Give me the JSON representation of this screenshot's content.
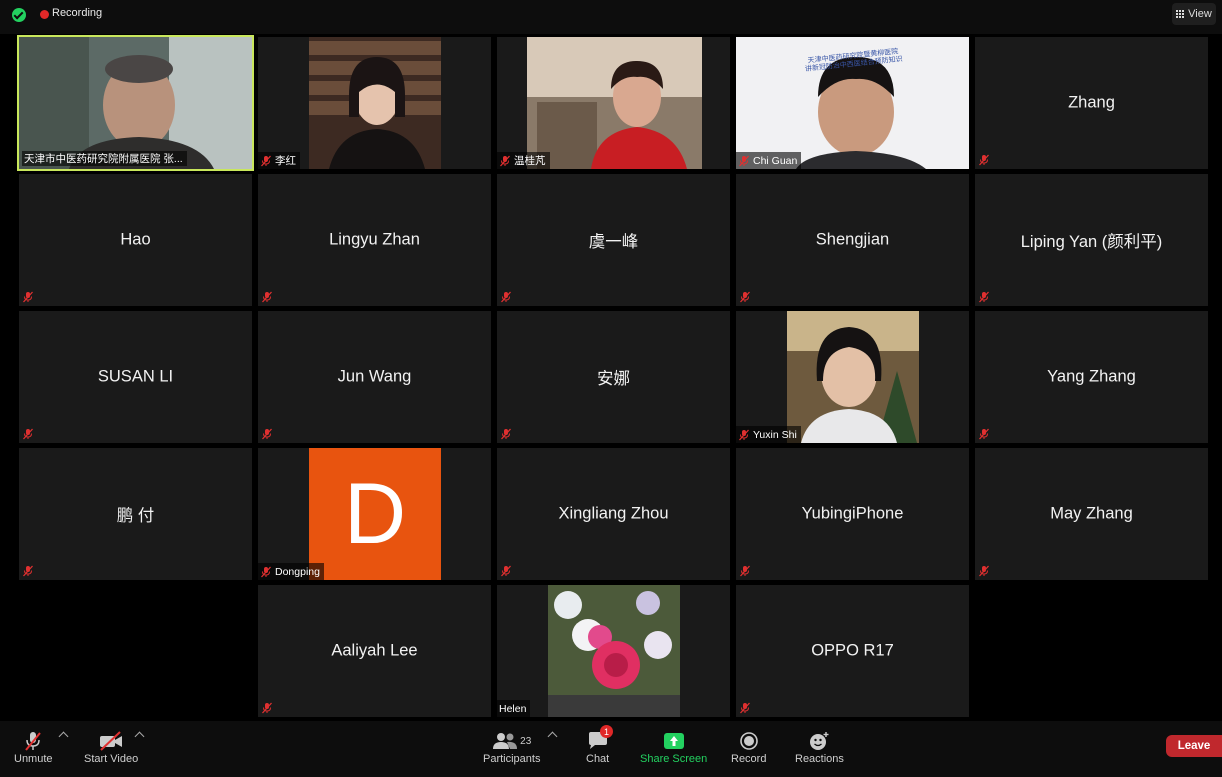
{
  "topbar": {
    "recording_label": "Recording",
    "view_label": "View"
  },
  "tiles": {
    "t1": "天津市中医药研究院附属医院 张...",
    "t2": "李红",
    "t3": "温桂芃",
    "t4": "Chi Guan",
    "t5": "Zhang",
    "t6": "Hao",
    "t7": "Lingyu Zhan",
    "t8": "虞一峰",
    "t9": "Shengjian",
    "t10": "Liping Yan (颜利平)",
    "t11": "SUSAN LI",
    "t12": "Jun Wang",
    "t13": "安娜",
    "t14": "Yuxin Shi",
    "t15": "Yang Zhang",
    "t16": "鹏 付",
    "t17": "Dongping",
    "t17_letter": "D",
    "t18": "Xingliang Zhou",
    "t19": "YubingiPhone",
    "t20": "May Zhang",
    "t21": "Aaliyah Lee",
    "t22": "Helen",
    "t23": "OPPO R17",
    "photo_banner": "天津中医药研究院暨黄柳医院\n讲新冠防治中西医结合预防知识"
  },
  "toolbar": {
    "unmute": "Unmute",
    "start_video": "Start Video",
    "participants": "Participants",
    "participants_count": "23",
    "chat": "Chat",
    "chat_badge": "1",
    "share_screen": "Share Screen",
    "record": "Record",
    "reactions": "Reactions",
    "leave": "Leave"
  },
  "colors": {
    "active_speaker": "#c9e75c",
    "recording": "#e02828",
    "leave": "#c0282d",
    "share": "#23d160",
    "dongping_avatar": "#e8540f"
  }
}
